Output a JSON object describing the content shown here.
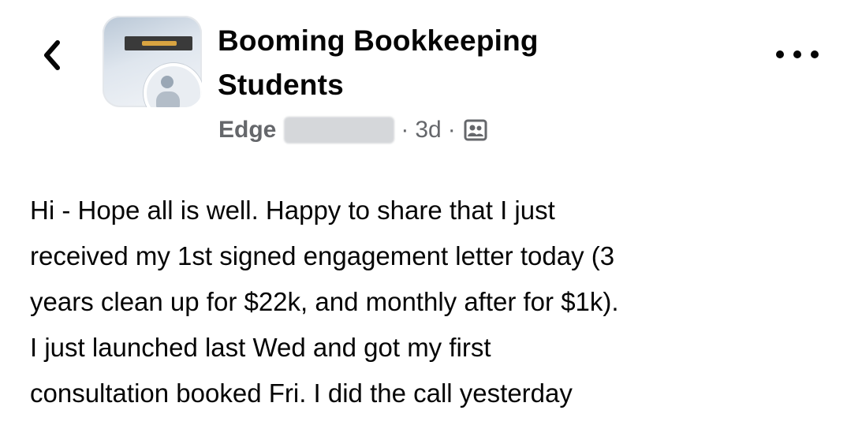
{
  "header": {
    "back_icon": "chevron-left-icon",
    "group_name_line1": "Booming Bookkeeping",
    "group_name_line2": "Students",
    "more_icon": "more-horizontal-icon"
  },
  "meta": {
    "author_first_name": "Edge",
    "separator": "·",
    "time_ago": "3d",
    "audience_icon": "group-members-icon"
  },
  "post": {
    "lines": [
      "Hi - Hope all is well. Happy to share that I just",
      "received my 1st signed engagement letter today (3",
      "years clean up for $22k, and monthly after for $1k).",
      "I just launched last Wed and got my first",
      "consultation booked Fri.  I did the call yesterday"
    ]
  },
  "colors": {
    "text_primary": "#050505",
    "text_secondary": "#65676b",
    "background": "#ffffff"
  }
}
